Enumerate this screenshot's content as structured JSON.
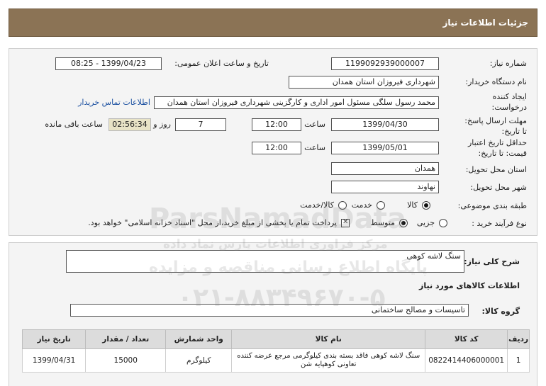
{
  "header": {
    "title": "جزئیات اطلاعات نیاز"
  },
  "info": {
    "need_number_label": "شماره نیاز:",
    "need_number": "1199092939000007",
    "announce_label": "تاریخ و ساعت اعلان عمومی:",
    "announce_value": "1399/04/23 - 08:25",
    "buyer_label": "نام دستگاه خریدار:",
    "buyer_value": "شهرداری فیروزان استان همدان",
    "creator_label1": "ایجاد کننده",
    "creator_label2": "درخواست:",
    "creator_value": "محمد رسول سلگی مسئول امور اداری و کارگزینی شهرداری فیروزان استان همدان",
    "contact_link": "اطلاعات تماس خریدار",
    "send_label1": "مهلت ارسال پاسخ:",
    "send_label2": "تا تاریخ:",
    "send_date": "1399/04/30",
    "time_label": "ساعت",
    "send_time": "12:00",
    "days_value": "7",
    "days_label": "روز و",
    "timer_value": "02:56:34",
    "remaining_label": "ساعت باقی مانده",
    "price_label1": "حداقل تاریخ اعتبار",
    "price_label2": "قیمت: تا تاریخ:",
    "price_date": "1399/05/01",
    "price_time": "12:00",
    "province_label": "استان محل تحویل:",
    "province_value": "همدان",
    "city_label": "شهر محل تحویل:",
    "city_value": "نهاوند",
    "category_label": "طبقه بندی موضوعی:",
    "cat_goods": "کالا",
    "cat_service": "خدمت",
    "cat_both": "کالا/خدمت",
    "process_label": "نوع فرآیند خرید :",
    "proc_minor": "جزیی",
    "proc_medium": "متوسط",
    "payment_text": "پرداخت تمام یا بخشی از مبلغ خرید،از محل \"اسناد خزانه اسلامی\" خواهد بود."
  },
  "details": {
    "summary_label": "شرح کلی نیاز:",
    "summary_value": "سنگ لاشه کوهی",
    "goods_title": "اطلاعات کالاهای مورد نیاز",
    "group_label": "گروه کالا:",
    "group_value": "تاسیسات و مصالح ساختمانی",
    "columns": [
      "ردیف",
      "کد کالا",
      "نام کالا",
      "واحد شمارش",
      "تعداد / مقدار",
      "تاریخ نیاز"
    ],
    "rows": [
      {
        "row": "1",
        "code": "0822414406000001",
        "name": "سنگ لاشه کوهی فاقد بسته بندی کیلوگرمی مرجع عرضه کننده تعاونی کوهپایه شن",
        "unit": "کیلوگرم",
        "qty": "15000",
        "date": "1399/04/31"
      }
    ]
  },
  "watermark": {
    "line1": "ParsNamadData",
    "line2": "مرکز فراوری اطلاعات پارس نماد داده",
    "line3": "پایگاه اطلاع رسانی مناقصه و مزایده",
    "line4": "۰۲۱-۸۸۳۴۹۶۷۰-۵"
  }
}
